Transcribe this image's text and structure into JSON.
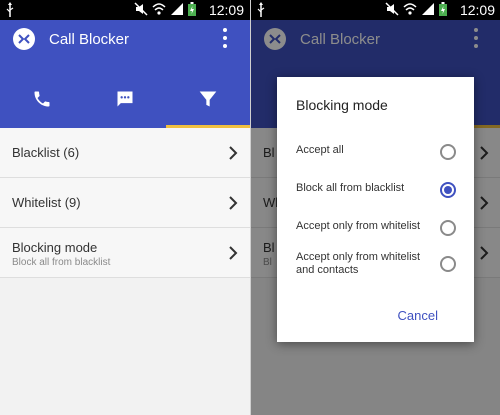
{
  "status_bar": {
    "time": "12:09"
  },
  "app": {
    "title": "Call Blocker"
  },
  "tabs": [
    {
      "icon": "phone-icon"
    },
    {
      "icon": "message-icon"
    },
    {
      "icon": "filter-icon",
      "selected": true
    }
  ],
  "list": {
    "items": [
      {
        "title": "Blacklist (6)"
      },
      {
        "title": "Whitelist (9)"
      },
      {
        "title": "Blocking mode",
        "subtitle": "Block all from blacklist"
      }
    ]
  },
  "background_list_fragments": [
    "Bl",
    "Wh",
    "Bl",
    "Bl"
  ],
  "dialog": {
    "title": "Blocking mode",
    "options": [
      {
        "label": "Accept all",
        "checked": false
      },
      {
        "label": "Block all from blacklist",
        "checked": true
      },
      {
        "label": "Accept only from whitelist",
        "checked": false
      },
      {
        "label": "Accept only from whitelist and contacts",
        "checked": false
      }
    ],
    "cancel_label": "Cancel"
  },
  "colors": {
    "primary": "#3f51c0",
    "tab_indicator": "#f0c040",
    "status_bar": "#000000",
    "battery": "#4caf50"
  }
}
